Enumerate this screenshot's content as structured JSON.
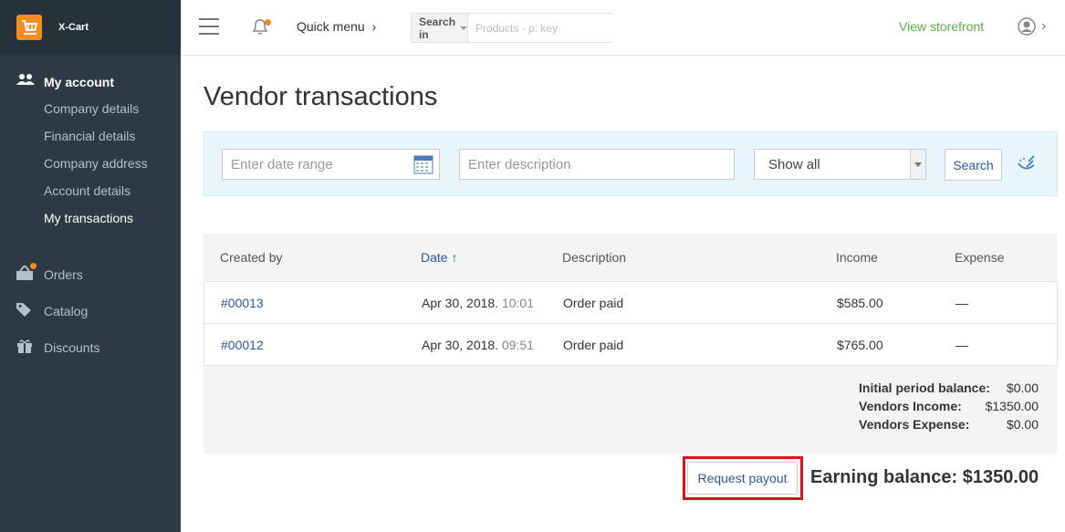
{
  "brand": {
    "name": "X-Cart",
    "accent": "#f68b1f"
  },
  "sidebar": {
    "section": {
      "label": "My account",
      "icon": "users-icon"
    },
    "subitems": [
      {
        "label": "Company details"
      },
      {
        "label": "Financial details"
      },
      {
        "label": "Company address"
      },
      {
        "label": "Account details"
      },
      {
        "label": "My transactions",
        "active": true
      }
    ],
    "items": [
      {
        "label": "Orders",
        "icon": "orders-icon",
        "badge_dot": true
      },
      {
        "label": "Catalog",
        "icon": "tag-icon"
      },
      {
        "label": "Discounts",
        "icon": "gift-icon"
      }
    ]
  },
  "topbar": {
    "quick_menu": "Quick menu",
    "search_scope": "Search in",
    "search_placeholder": "Products - p: key",
    "view_storefront": "View storefront"
  },
  "page": {
    "title": "Vendor transactions"
  },
  "filter": {
    "date_placeholder": "Enter date range",
    "description_placeholder": "Enter description",
    "type_selected": "Show all",
    "search_label": "Search"
  },
  "table": {
    "headers": [
      "Created by",
      "Date",
      "Description",
      "Income",
      "Expense"
    ],
    "sort_indicator": "↑",
    "rows": [
      {
        "created_by": "#00013",
        "date": "Apr 30, 2018.",
        "time": "10:01",
        "description": "Order paid",
        "income": "$585.00",
        "expense": "—"
      },
      {
        "created_by": "#00012",
        "date": "Apr 30, 2018.",
        "time": "09:51",
        "description": "Order paid",
        "income": "$765.00",
        "expense": "—"
      }
    ],
    "totals": [
      {
        "label": "Initial period balance:",
        "value": "$0.00"
      },
      {
        "label": "Vendors Income:",
        "value": "$1350.00"
      },
      {
        "label": "Vendors Expense:",
        "value": "$0.00"
      }
    ]
  },
  "footer": {
    "request_payout": "Request payout",
    "earning_balance": "Earning balance: $1350.00"
  }
}
